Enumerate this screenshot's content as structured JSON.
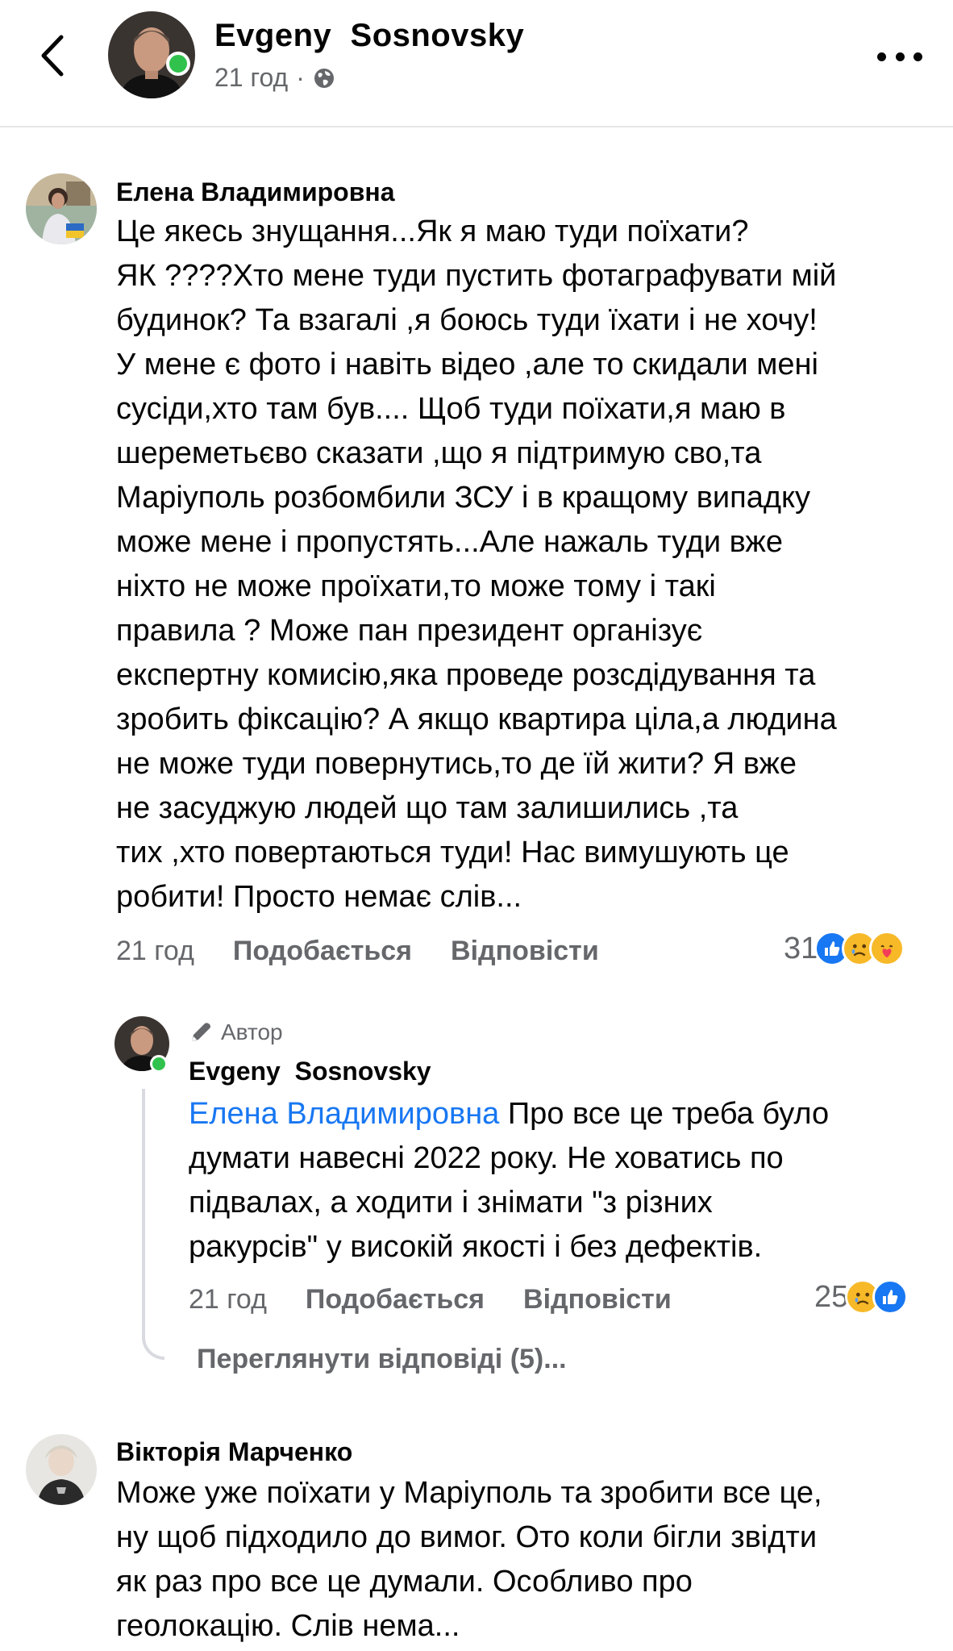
{
  "header": {
    "author_name": "Evgeny  Sosnovsky",
    "time": "21 год",
    "separator": "·",
    "audience_icon": "globe-icon"
  },
  "comments": [
    {
      "author": "Елена Владимировна",
      "lines": [
        "Це якесь знущання...Як я маю туди поїхати?",
        "ЯК ????Хто мене туди пустить фотаграфувати мій",
        "будинок? Та взагалі ,я боюсь туди їхати і не хочу!",
        "У мене є фото і навіть відео ,але то скидали мені",
        "сусіди,хто там був.... Щоб туди поїхати,я маю в",
        "шереметьєво сказати ,що я підтримую сво,та",
        "Маріуполь розбомбили ЗСУ  і в кращому випадку",
        "може мене і пропустять...Але нажаль туди вже",
        "ніхто не може проїхати,то може тому і такі",
        "правила ? Може пан президент організує",
        "експертну комисію,яка проведе розсдідування та",
        "зробить фіксацію? А якщо квартира ціла,а людина",
        "не може туди повернутись,то де їй жити? Я вже",
        "не засуджую людей що там залишились ,та",
        "тих ,хто повертаються туди! Нас вимушують це",
        "робити! Просто немає слів..."
      ],
      "time": "21 год",
      "like_label": "Подобається",
      "reply_label": "Відповісти",
      "reaction_count": "31",
      "reactions": [
        "like",
        "sad",
        "care"
      ]
    },
    {
      "badge": "Автор",
      "author": "Evgeny  Sosnovsky",
      "mention": "Елена Владимировна",
      "first_line_rest": " Про все це треба було",
      "lines": [
        "думати навесні 2022 року. Не ховатись по",
        "підвалах, а ходити і знімати \"з різних",
        "ракурсів\" у високій якості і без дефектів."
      ],
      "time": "21 год",
      "like_label": "Подобається",
      "reply_label": "Відповісти",
      "reaction_count": "25",
      "reactions": [
        "sad",
        "like"
      ],
      "view_replies": "Переглянути відповіді (5)..."
    },
    {
      "author": "Вікторія Марченко",
      "lines": [
        "Може уже поїхати у Маріуполь  та зробити все це,",
        "ну щоб підходило до вимог. Ото коли бігли звідти",
        "як раз про все це думали. Особливо про",
        "геолокацію. Слів нема..."
      ]
    }
  ],
  "colors": {
    "secondary_text": "#65676b",
    "mention": "#1877f2",
    "online": "#31c24d",
    "like_blue": "#1877f2",
    "emoji_yellow": "#f7b928"
  }
}
